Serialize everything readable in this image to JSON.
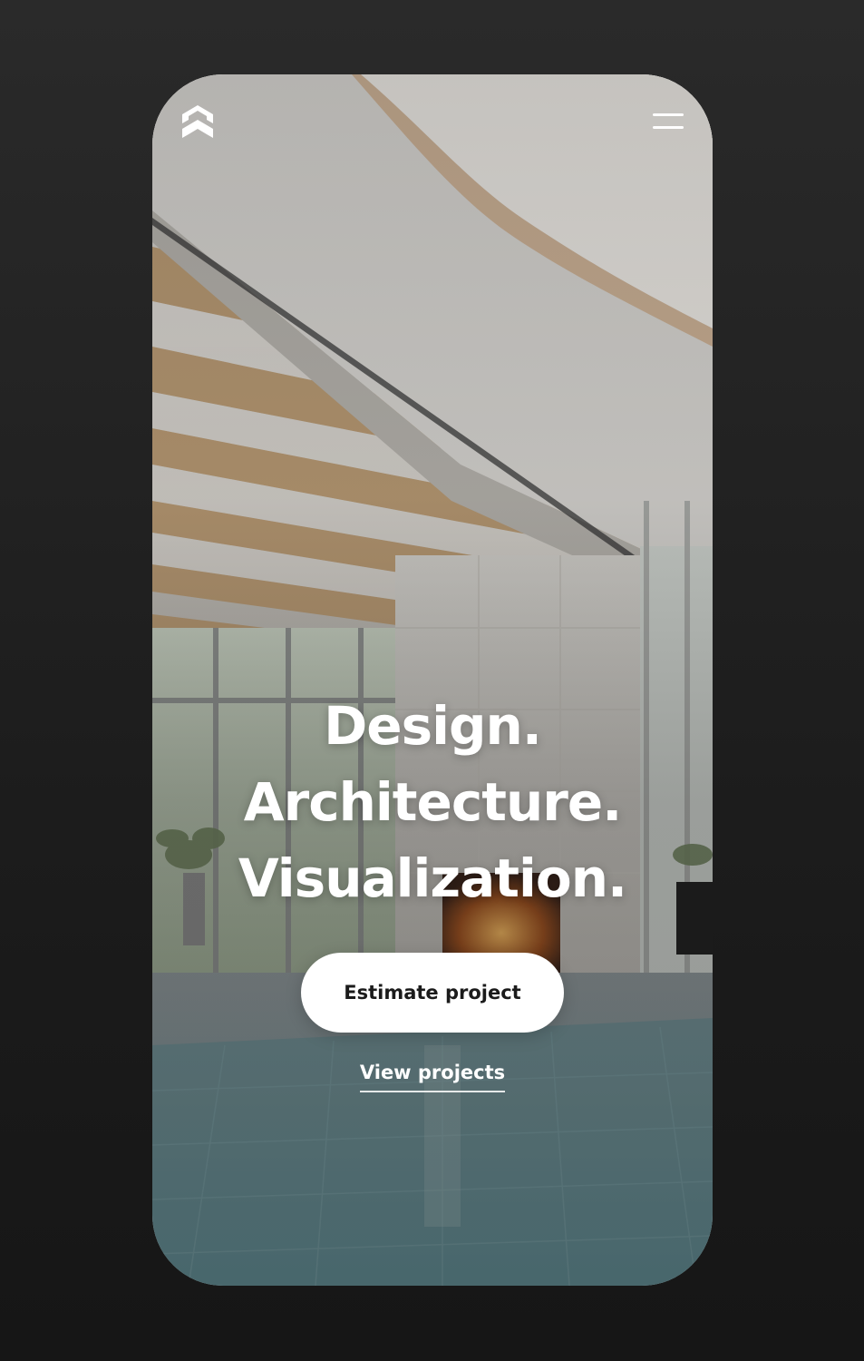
{
  "header": {
    "logo_icon": "house-chevron-logo-icon",
    "menu_icon": "hamburger-menu-icon"
  },
  "hero": {
    "lines": [
      "Design.",
      "Architecture.",
      "Visualization."
    ]
  },
  "actions": {
    "primary_label": "Estimate project",
    "secondary_label": "View projects"
  },
  "colors": {
    "page_background": "#1c1c1c",
    "button_background": "#ffffff",
    "button_text": "#1b1b1b",
    "hero_text": "#ffffff"
  }
}
